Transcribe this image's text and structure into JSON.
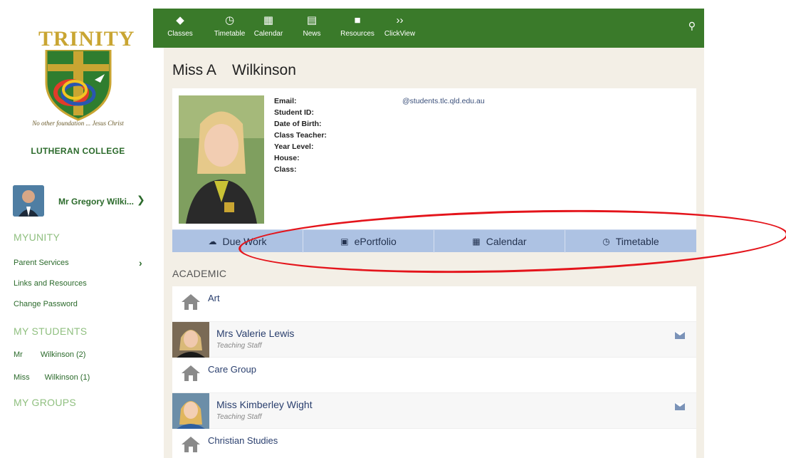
{
  "logo": {
    "wordmark": "TRINITY",
    "motto": "No other foundation ... Jesus Christ",
    "subtitle": "LUTHERAN COLLEGE"
  },
  "user": {
    "name": "Mr Gregory Wilki..."
  },
  "sidebar": {
    "myunity_heading": "MYUNITY",
    "links": [
      {
        "label": "Parent Services"
      },
      {
        "label": "Links and Resources"
      },
      {
        "label": "Change Password"
      }
    ],
    "students_heading": "MY STUDENTS",
    "students": [
      {
        "prefix": "Mr",
        "name": "Wilkinson (2)"
      },
      {
        "prefix": "Miss",
        "name": "Wilkinson (1)"
      }
    ],
    "groups_heading": "MY GROUPS"
  },
  "nav": {
    "items": [
      {
        "label": "Classes",
        "icon": "graduation-cap-icon"
      },
      {
        "label": "Timetable",
        "icon": "clock-icon"
      },
      {
        "label": "Calendar",
        "icon": "calendar-icon"
      },
      {
        "label": "News",
        "icon": "newspaper-icon"
      },
      {
        "label": "Resources",
        "icon": "folder-icon"
      },
      {
        "label": "ClickView",
        "icon": "double-chevron-icon"
      }
    ],
    "search_icon": "search-icon"
  },
  "profile": {
    "title": "Miss A    Wilkinson",
    "fields": [
      {
        "label": "Email:",
        "value": "@students.tlc.qld.edu.au"
      },
      {
        "label": "Student ID:",
        "value": ""
      },
      {
        "label": "Date of Birth:",
        "value": ""
      },
      {
        "label": "Class Teacher:",
        "value": ""
      },
      {
        "label": "Year Level:",
        "value": ""
      },
      {
        "label": "House:",
        "value": ""
      },
      {
        "label": "Class:",
        "value": ""
      }
    ]
  },
  "actions": [
    {
      "label": "Due Work",
      "icon": "cloud-icon"
    },
    {
      "label": "ePortfolio",
      "icon": "briefcase-icon"
    },
    {
      "label": "Calendar",
      "icon": "calendar-icon"
    },
    {
      "label": "Timetable",
      "icon": "clock-icon"
    }
  ],
  "academic": {
    "heading": "ACADEMIC",
    "items": [
      {
        "type": "subject",
        "name": "Art"
      },
      {
        "type": "teacher",
        "name": "Mrs Valerie Lewis",
        "role": "Teaching Staff"
      },
      {
        "type": "subject",
        "name": "Care Group"
      },
      {
        "type": "teacher",
        "name": "Miss Kimberley Wight",
        "role": "Teaching Staff"
      },
      {
        "type": "subject",
        "name": "Christian Studies"
      }
    ]
  },
  "colors": {
    "nav_green": "#3a7a2a",
    "sidebar_green": "#2b6a2b",
    "heading_light_green": "#8fbf7f",
    "action_blue": "#adc2e3",
    "annotation_red": "#e4141b"
  }
}
